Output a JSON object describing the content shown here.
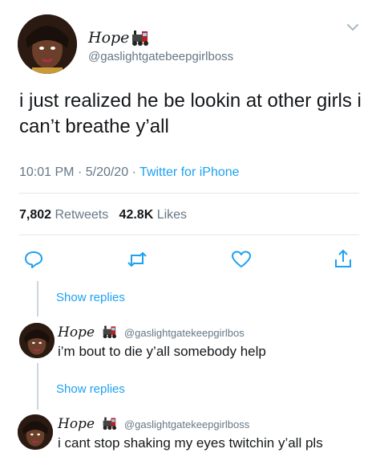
{
  "main": {
    "author_name": "Hope",
    "author_handle": "@gaslightgatebeepgirlboss",
    "text": "i just realized he be lookin at other girls i can’t breathe y’all",
    "meta": {
      "time": "10:01 PM",
      "sep1": "·",
      "date": "5/20/20",
      "sep2": "·",
      "source": "Twitter for iPhone"
    },
    "stats": {
      "retweets_count": "7,802",
      "retweets_label": "Retweets",
      "likes_count": "42.8K",
      "likes_label": "Likes"
    }
  },
  "replies": [
    {
      "show_replies_label": "Show replies",
      "author_name": "Hope",
      "author_handle": "@gaslightgatekeepgirlbos",
      "text": "i’m bout to die y’all somebody help"
    },
    {
      "show_replies_label": "Show replies",
      "author_name": "Hope",
      "author_handle": "@gaslightgatekeepgirlboss",
      "text": "i cant stop shaking my eyes twitchin y’all pls"
    }
  ],
  "icons": {
    "chevron": "chevron-down-icon",
    "reply": "reply-icon",
    "retweet": "retweet-icon",
    "like": "heart-icon",
    "share": "share-icon",
    "name_emoji": "train-icon"
  },
  "colors": {
    "link_blue": "#1da1f2",
    "secondary_text": "#657786",
    "divider": "#e1e8ed",
    "thread_line": "#ccd6dd"
  }
}
